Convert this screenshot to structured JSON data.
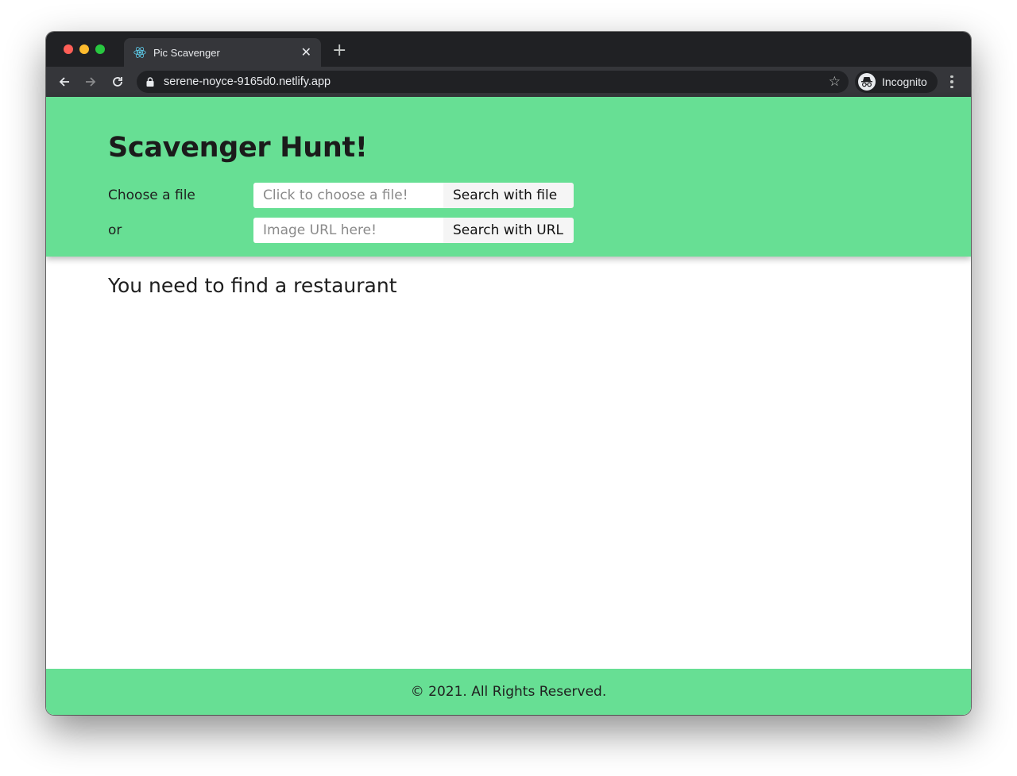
{
  "browser": {
    "tab_title": "Pic Scavenger",
    "tab_icon": "react-icon",
    "url": "serene-noyce-9165d0.netlify.app",
    "profile_label": "Incognito",
    "traffic_lights": {
      "close": "#ff5f57",
      "minimize": "#febc2e",
      "maximize": "#28c840"
    }
  },
  "header": {
    "title": "Scavenger Hunt!",
    "file_row": {
      "label": "Choose a file",
      "placeholder": "Click to choose a file!",
      "button": "Search with file"
    },
    "url_row": {
      "label": "or",
      "placeholder": "Image URL here!",
      "button": "Search with URL"
    }
  },
  "main": {
    "prompt": "You need to find a restaurant"
  },
  "footer": {
    "text": "© 2021. All Rights Reserved."
  },
  "colors": {
    "accent_green": "#67df94",
    "chrome_dark": "#202124",
    "chrome_toolbar": "#35363a"
  }
}
